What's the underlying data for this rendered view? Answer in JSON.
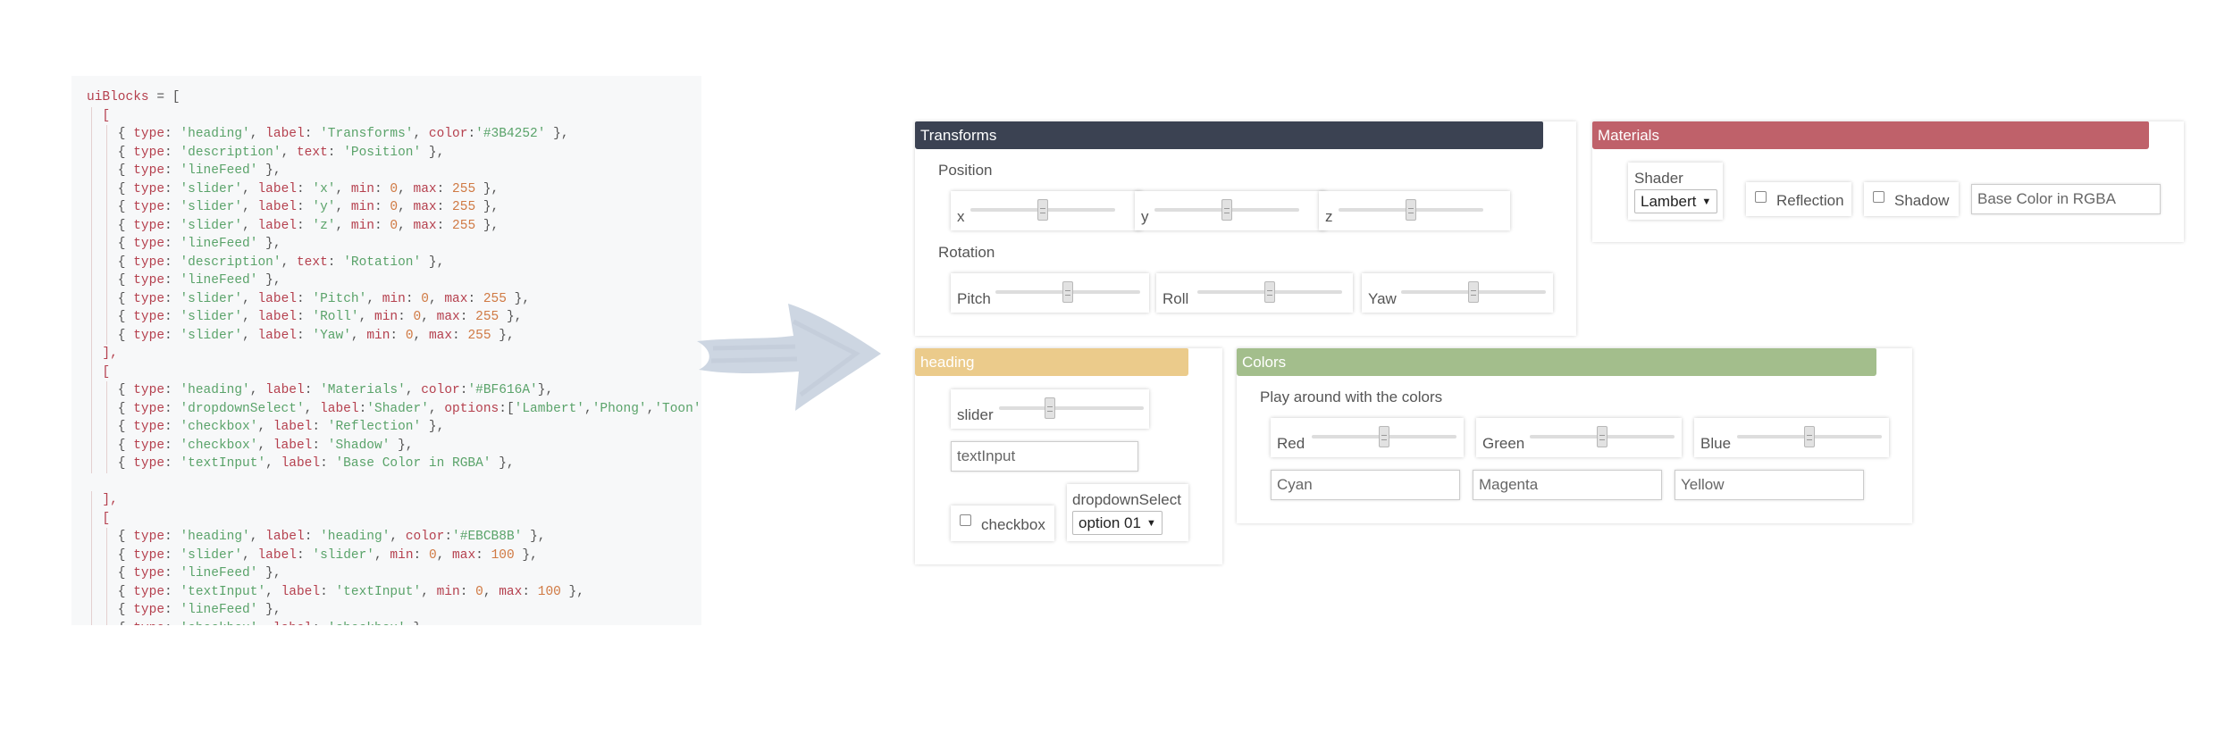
{
  "code": {
    "lines": [
      [
        [
          "k",
          "uiBlocks"
        ],
        [
          "p",
          " = ["
        ]
      ],
      [
        [
          "p",
          "  "
        ],
        [
          "k",
          "["
        ]
      ],
      [
        [
          "p",
          "    { "
        ],
        [
          "k",
          "type"
        ],
        [
          "p",
          ": "
        ],
        [
          "s",
          "'heading'"
        ],
        [
          "p",
          ", "
        ],
        [
          "k",
          "label"
        ],
        [
          "p",
          ": "
        ],
        [
          "s",
          "'Transforms'"
        ],
        [
          "p",
          ", "
        ],
        [
          "k",
          "color"
        ],
        [
          "p",
          ":"
        ],
        [
          "s",
          "'#3B4252'"
        ],
        [
          "p",
          " },"
        ]
      ],
      [
        [
          "p",
          "    { "
        ],
        [
          "k",
          "type"
        ],
        [
          "p",
          ": "
        ],
        [
          "s",
          "'description'"
        ],
        [
          "p",
          ", "
        ],
        [
          "k",
          "text"
        ],
        [
          "p",
          ": "
        ],
        [
          "s",
          "'Position'"
        ],
        [
          "p",
          " },"
        ]
      ],
      [
        [
          "p",
          "    { "
        ],
        [
          "k",
          "type"
        ],
        [
          "p",
          ": "
        ],
        [
          "s",
          "'lineFeed'"
        ],
        [
          "p",
          " },"
        ]
      ],
      [
        [
          "p",
          "    { "
        ],
        [
          "k",
          "type"
        ],
        [
          "p",
          ": "
        ],
        [
          "s",
          "'slider'"
        ],
        [
          "p",
          ", "
        ],
        [
          "k",
          "label"
        ],
        [
          "p",
          ": "
        ],
        [
          "s",
          "'x'"
        ],
        [
          "p",
          ", "
        ],
        [
          "k",
          "min"
        ],
        [
          "p",
          ": "
        ],
        [
          "n",
          "0"
        ],
        [
          "p",
          ", "
        ],
        [
          "k",
          "max"
        ],
        [
          "p",
          ": "
        ],
        [
          "n",
          "255"
        ],
        [
          "p",
          " },"
        ]
      ],
      [
        [
          "p",
          "    { "
        ],
        [
          "k",
          "type"
        ],
        [
          "p",
          ": "
        ],
        [
          "s",
          "'slider'"
        ],
        [
          "p",
          ", "
        ],
        [
          "k",
          "label"
        ],
        [
          "p",
          ": "
        ],
        [
          "s",
          "'y'"
        ],
        [
          "p",
          ", "
        ],
        [
          "k",
          "min"
        ],
        [
          "p",
          ": "
        ],
        [
          "n",
          "0"
        ],
        [
          "p",
          ", "
        ],
        [
          "k",
          "max"
        ],
        [
          "p",
          ": "
        ],
        [
          "n",
          "255"
        ],
        [
          "p",
          " },"
        ]
      ],
      [
        [
          "p",
          "    { "
        ],
        [
          "k",
          "type"
        ],
        [
          "p",
          ": "
        ],
        [
          "s",
          "'slider'"
        ],
        [
          "p",
          ", "
        ],
        [
          "k",
          "label"
        ],
        [
          "p",
          ": "
        ],
        [
          "s",
          "'z'"
        ],
        [
          "p",
          ", "
        ],
        [
          "k",
          "min"
        ],
        [
          "p",
          ": "
        ],
        [
          "n",
          "0"
        ],
        [
          "p",
          ", "
        ],
        [
          "k",
          "max"
        ],
        [
          "p",
          ": "
        ],
        [
          "n",
          "255"
        ],
        [
          "p",
          " },"
        ]
      ],
      [
        [
          "p",
          "    { "
        ],
        [
          "k",
          "type"
        ],
        [
          "p",
          ": "
        ],
        [
          "s",
          "'lineFeed'"
        ],
        [
          "p",
          " },"
        ]
      ],
      [
        [
          "p",
          "    { "
        ],
        [
          "k",
          "type"
        ],
        [
          "p",
          ": "
        ],
        [
          "s",
          "'description'"
        ],
        [
          "p",
          ", "
        ],
        [
          "k",
          "text"
        ],
        [
          "p",
          ": "
        ],
        [
          "s",
          "'Rotation'"
        ],
        [
          "p",
          " },"
        ]
      ],
      [
        [
          "p",
          "    { "
        ],
        [
          "k",
          "type"
        ],
        [
          "p",
          ": "
        ],
        [
          "s",
          "'lineFeed'"
        ],
        [
          "p",
          " },"
        ]
      ],
      [
        [
          "p",
          "    { "
        ],
        [
          "k",
          "type"
        ],
        [
          "p",
          ": "
        ],
        [
          "s",
          "'slider'"
        ],
        [
          "p",
          ", "
        ],
        [
          "k",
          "label"
        ],
        [
          "p",
          ": "
        ],
        [
          "s",
          "'Pitch'"
        ],
        [
          "p",
          ", "
        ],
        [
          "k",
          "min"
        ],
        [
          "p",
          ": "
        ],
        [
          "n",
          "0"
        ],
        [
          "p",
          ", "
        ],
        [
          "k",
          "max"
        ],
        [
          "p",
          ": "
        ],
        [
          "n",
          "255"
        ],
        [
          "p",
          " },"
        ]
      ],
      [
        [
          "p",
          "    { "
        ],
        [
          "k",
          "type"
        ],
        [
          "p",
          ": "
        ],
        [
          "s",
          "'slider'"
        ],
        [
          "p",
          ", "
        ],
        [
          "k",
          "label"
        ],
        [
          "p",
          ": "
        ],
        [
          "s",
          "'Roll'"
        ],
        [
          "p",
          ", "
        ],
        [
          "k",
          "min"
        ],
        [
          "p",
          ": "
        ],
        [
          "n",
          "0"
        ],
        [
          "p",
          ", "
        ],
        [
          "k",
          "max"
        ],
        [
          "p",
          ": "
        ],
        [
          "n",
          "255"
        ],
        [
          "p",
          " },"
        ]
      ],
      [
        [
          "p",
          "    { "
        ],
        [
          "k",
          "type"
        ],
        [
          "p",
          ": "
        ],
        [
          "s",
          "'slider'"
        ],
        [
          "p",
          ", "
        ],
        [
          "k",
          "label"
        ],
        [
          "p",
          ": "
        ],
        [
          "s",
          "'Yaw'"
        ],
        [
          "p",
          ", "
        ],
        [
          "k",
          "min"
        ],
        [
          "p",
          ": "
        ],
        [
          "n",
          "0"
        ],
        [
          "p",
          ", "
        ],
        [
          "k",
          "max"
        ],
        [
          "p",
          ": "
        ],
        [
          "n",
          "255"
        ],
        [
          "p",
          " },"
        ]
      ],
      [
        [
          "p",
          "  "
        ],
        [
          "k",
          "],"
        ]
      ],
      [
        [
          "p",
          "  "
        ],
        [
          "k",
          "["
        ]
      ],
      [
        [
          "p",
          "    { "
        ],
        [
          "k",
          "type"
        ],
        [
          "p",
          ": "
        ],
        [
          "s",
          "'heading'"
        ],
        [
          "p",
          ", "
        ],
        [
          "k",
          "label"
        ],
        [
          "p",
          ": "
        ],
        [
          "s",
          "'Materials'"
        ],
        [
          "p",
          ", "
        ],
        [
          "k",
          "color"
        ],
        [
          "p",
          ":"
        ],
        [
          "s",
          "'#BF616A'"
        ],
        [
          "p",
          "},"
        ]
      ],
      [
        [
          "p",
          "    { "
        ],
        [
          "k",
          "type"
        ],
        [
          "p",
          ": "
        ],
        [
          "s",
          "'dropdownSelect'"
        ],
        [
          "p",
          ", "
        ],
        [
          "k",
          "label"
        ],
        [
          "p",
          ":"
        ],
        [
          "s",
          "'Shader'"
        ],
        [
          "p",
          ", "
        ],
        [
          "k",
          "options"
        ],
        [
          "p",
          ":["
        ],
        [
          "s",
          "'Lambert'"
        ],
        [
          "p",
          ","
        ],
        [
          "s",
          "'Phong'"
        ],
        [
          "p",
          ","
        ],
        [
          "s",
          "'Toon'"
        ],
        [
          "p",
          "]},"
        ]
      ],
      [
        [
          "p",
          "    { "
        ],
        [
          "k",
          "type"
        ],
        [
          "p",
          ": "
        ],
        [
          "s",
          "'checkbox'"
        ],
        [
          "p",
          ", "
        ],
        [
          "k",
          "label"
        ],
        [
          "p",
          ": "
        ],
        [
          "s",
          "'Reflection'"
        ],
        [
          "p",
          " },"
        ]
      ],
      [
        [
          "p",
          "    { "
        ],
        [
          "k",
          "type"
        ],
        [
          "p",
          ": "
        ],
        [
          "s",
          "'checkbox'"
        ],
        [
          "p",
          ", "
        ],
        [
          "k",
          "label"
        ],
        [
          "p",
          ": "
        ],
        [
          "s",
          "'Shadow'"
        ],
        [
          "p",
          " },"
        ]
      ],
      [
        [
          "p",
          "    { "
        ],
        [
          "k",
          "type"
        ],
        [
          "p",
          ": "
        ],
        [
          "s",
          "'textInput'"
        ],
        [
          "p",
          ", "
        ],
        [
          "k",
          "label"
        ],
        [
          "p",
          ": "
        ],
        [
          "s",
          "'Base Color in RGBA'"
        ],
        [
          "p",
          " },"
        ]
      ],
      [
        [
          "p",
          ""
        ]
      ],
      [
        [
          "p",
          "  "
        ],
        [
          "k",
          "],"
        ]
      ],
      [
        [
          "p",
          "  "
        ],
        [
          "k",
          "["
        ]
      ],
      [
        [
          "p",
          "    { "
        ],
        [
          "k",
          "type"
        ],
        [
          "p",
          ": "
        ],
        [
          "s",
          "'heading'"
        ],
        [
          "p",
          ", "
        ],
        [
          "k",
          "label"
        ],
        [
          "p",
          ": "
        ],
        [
          "s",
          "'heading'"
        ],
        [
          "p",
          ", "
        ],
        [
          "k",
          "color"
        ],
        [
          "p",
          ":"
        ],
        [
          "s",
          "'#EBCB8B'"
        ],
        [
          "p",
          " },"
        ]
      ],
      [
        [
          "p",
          "    { "
        ],
        [
          "k",
          "type"
        ],
        [
          "p",
          ": "
        ],
        [
          "s",
          "'slider'"
        ],
        [
          "p",
          ", "
        ],
        [
          "k",
          "label"
        ],
        [
          "p",
          ": "
        ],
        [
          "s",
          "'slider'"
        ],
        [
          "p",
          ", "
        ],
        [
          "k",
          "min"
        ],
        [
          "p",
          ": "
        ],
        [
          "n",
          "0"
        ],
        [
          "p",
          ", "
        ],
        [
          "k",
          "max"
        ],
        [
          "p",
          ": "
        ],
        [
          "n",
          "100"
        ],
        [
          "p",
          " },"
        ]
      ],
      [
        [
          "p",
          "    { "
        ],
        [
          "k",
          "type"
        ],
        [
          "p",
          ": "
        ],
        [
          "s",
          "'lineFeed'"
        ],
        [
          "p",
          " },"
        ]
      ],
      [
        [
          "p",
          "    { "
        ],
        [
          "k",
          "type"
        ],
        [
          "p",
          ": "
        ],
        [
          "s",
          "'textInput'"
        ],
        [
          "p",
          ", "
        ],
        [
          "k",
          "label"
        ],
        [
          "p",
          ": "
        ],
        [
          "s",
          "'textInput'"
        ],
        [
          "p",
          ", "
        ],
        [
          "k",
          "min"
        ],
        [
          "p",
          ": "
        ],
        [
          "n",
          "0"
        ],
        [
          "p",
          ", "
        ],
        [
          "k",
          "max"
        ],
        [
          "p",
          ": "
        ],
        [
          "n",
          "100"
        ],
        [
          "p",
          " },"
        ]
      ],
      [
        [
          "p",
          "    { "
        ],
        [
          "k",
          "type"
        ],
        [
          "p",
          ": "
        ],
        [
          "s",
          "'lineFeed'"
        ],
        [
          "p",
          " },"
        ]
      ],
      [
        [
          "p",
          "    { "
        ],
        [
          "k",
          "type"
        ],
        [
          "p",
          ": "
        ],
        [
          "s",
          "'checkbox'"
        ],
        [
          "p",
          ", "
        ],
        [
          "k",
          "label"
        ],
        [
          "p",
          ": "
        ],
        [
          "s",
          "'checkbox'"
        ],
        [
          "p",
          " },"
        ]
      ]
    ]
  },
  "colors": {
    "transforms": "#3B4252",
    "materials": "#BF616A",
    "heading": "#EBCB8B",
    "colors": "#A3BE8C"
  },
  "transforms": {
    "title": "Transforms",
    "position_label": "Position",
    "rotation_label": "Rotation",
    "sliders": {
      "x": {
        "label": "x",
        "value": 0.5
      },
      "y": {
        "label": "y",
        "value": 0.5
      },
      "z": {
        "label": "z",
        "value": 0.5
      },
      "pitch": {
        "label": "Pitch",
        "value": 0.5
      },
      "roll": {
        "label": "Roll",
        "value": 0.5
      },
      "yaw": {
        "label": "Yaw",
        "value": 0.5
      }
    }
  },
  "materials": {
    "title": "Materials",
    "shader_label": "Shader",
    "shader_value": "Lambert",
    "reflection_label": "Reflection",
    "shadow_label": "Shadow",
    "base_color_placeholder": "Base Color in RGBA"
  },
  "heading_panel": {
    "title": "heading",
    "slider_label": "slider",
    "slider_value": 0.35,
    "textinput_placeholder": "textInput",
    "checkbox_label": "checkbox",
    "dropdown_label": "dropdownSelect",
    "dropdown_value": "option 01"
  },
  "colors_panel": {
    "title": "Colors",
    "description": "Play around with the colors",
    "red_label": "Red",
    "red_value": 0.5,
    "green_label": "Green",
    "green_value": 0.5,
    "blue_label": "Blue",
    "blue_value": 0.5,
    "cyan_placeholder": "Cyan",
    "magenta_placeholder": "Magenta",
    "yellow_placeholder": "Yellow"
  }
}
